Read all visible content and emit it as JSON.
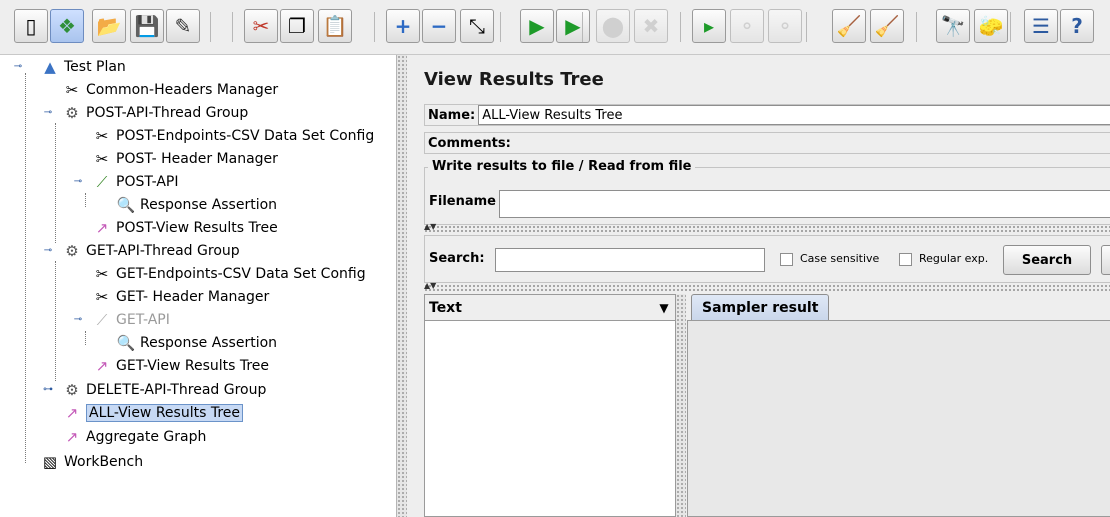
{
  "toolbar": {
    "buttons": [
      {
        "name": "new-icon",
        "glyph": "▯"
      },
      {
        "name": "templates-icon",
        "glyph": "❖"
      },
      {
        "name": "open-icon",
        "glyph": "📂"
      },
      {
        "name": "save-icon",
        "glyph": "💾"
      },
      {
        "name": "save-as-icon",
        "glyph": "✎"
      },
      {
        "name": "cut-icon",
        "glyph": "✂"
      },
      {
        "name": "copy-icon",
        "glyph": "❐"
      },
      {
        "name": "paste-icon",
        "glyph": "📋"
      },
      {
        "name": "expand-all-icon",
        "glyph": "+"
      },
      {
        "name": "collapse-all-icon",
        "glyph": "−"
      },
      {
        "name": "toggle-icon",
        "glyph": "⤡"
      },
      {
        "name": "start-icon",
        "glyph": "▶"
      },
      {
        "name": "start-no-pauses-icon",
        "glyph": "▶"
      },
      {
        "name": "stop-icon",
        "glyph": "⬤"
      },
      {
        "name": "shutdown-icon",
        "glyph": "✖"
      },
      {
        "name": "remote-start-icon",
        "glyph": "▸"
      },
      {
        "name": "remote-stop-icon",
        "glyph": "⚬"
      },
      {
        "name": "remote-shutdown-icon",
        "glyph": "⚬"
      },
      {
        "name": "clear-icon",
        "glyph": "🧹"
      },
      {
        "name": "clear-all-icon",
        "glyph": "🧹"
      },
      {
        "name": "search-icon",
        "glyph": "🔭"
      },
      {
        "name": "reset-search-icon",
        "glyph": "🧽"
      },
      {
        "name": "function-helper-icon",
        "glyph": "☰"
      },
      {
        "name": "help-icon",
        "glyph": "?"
      }
    ]
  },
  "tree": {
    "test_plan": "Test Plan",
    "common_headers": "Common-Headers Manager",
    "post_group": "POST-API-Thread Group",
    "post_csv": "POST-Endpoints-CSV Data Set Config",
    "post_header": "POST- Header Manager",
    "post_api": "POST-API",
    "post_assert": "Response Assertion",
    "post_vrt": "POST-View Results Tree",
    "get_group": "GET-API-Thread Group",
    "get_csv": "GET-Endpoints-CSV Data Set Config",
    "get_header": "GET- Header Manager",
    "get_api": "GET-API",
    "get_assert": "Response Assertion",
    "get_vrt": "GET-View Results Tree",
    "delete_group": "DELETE-API-Thread Group",
    "all_vrt": "ALL-View Results Tree",
    "aggregate": "Aggregate Graph",
    "workbench": "WorkBench"
  },
  "panel": {
    "title": "View Results Tree",
    "name_label": "Name:",
    "name_value": "ALL-View Results Tree",
    "comments_label": "Comments:",
    "comments_value": "",
    "file_legend": "Write results to file / Read from file",
    "filename_label": "Filename",
    "filename_value": "",
    "search_label": "Search:",
    "search_value": "",
    "case_sensitive": "Case sensitive",
    "regular_exp": "Regular exp.",
    "search_button": "Search",
    "renderer_selected": "Text",
    "tab_sampler_result": "Sampler result"
  },
  "colors": {
    "selection_bg": "#c7d9f4",
    "selection_border": "#6b93c9",
    "disabled_text": "#9a9a9a"
  }
}
